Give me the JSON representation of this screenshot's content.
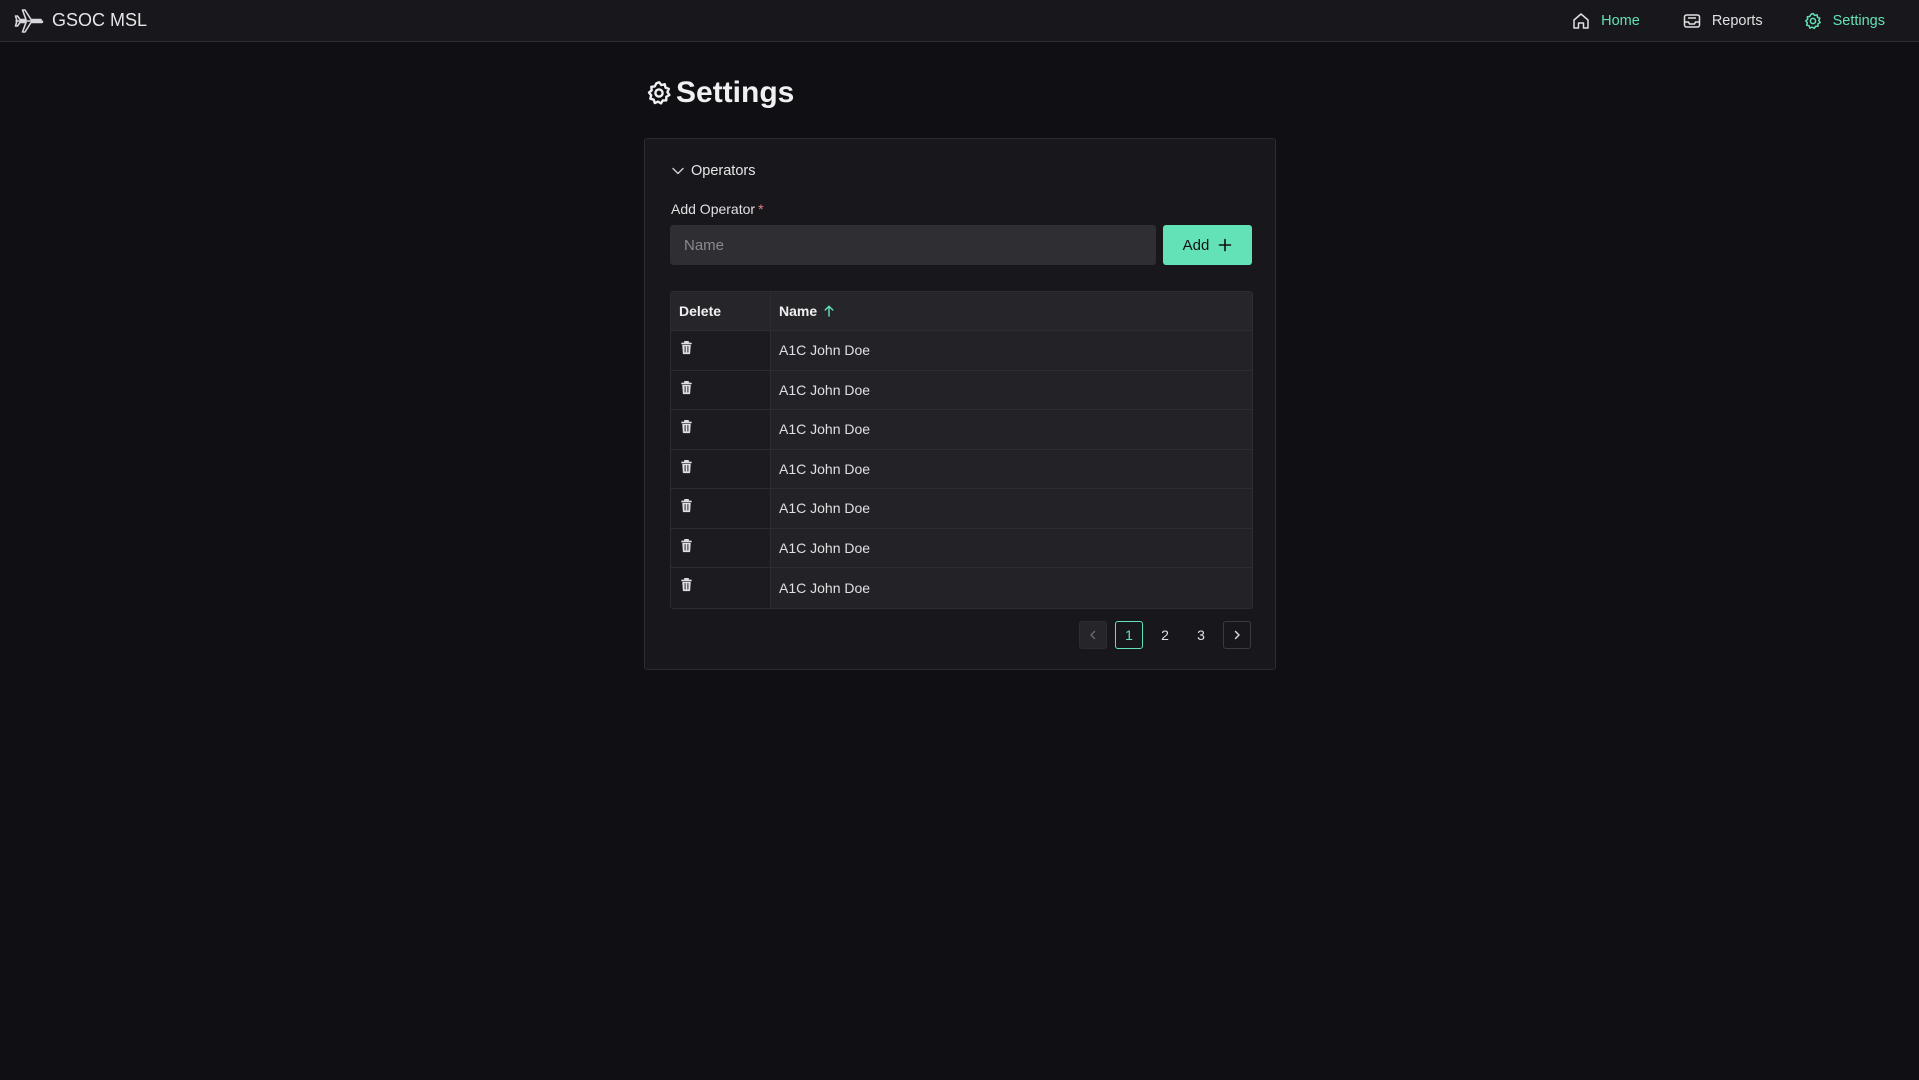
{
  "app": {
    "title": "GSOC MSL"
  },
  "nav": {
    "items": [
      {
        "label": "Home",
        "icon": "home-icon",
        "active": false
      },
      {
        "label": "Reports",
        "icon": "reports-icon",
        "active": false
      },
      {
        "label": "Settings",
        "icon": "settings-icon",
        "active": true
      }
    ]
  },
  "page": {
    "title": "Settings"
  },
  "operators": {
    "section_label": "Operators",
    "add_label": "Add Operator",
    "required_mark": "*",
    "name_placeholder": "Name",
    "name_value": "",
    "add_button": "Add",
    "table": {
      "columns": [
        "Delete",
        "Name"
      ],
      "sort_column": "Name",
      "sort_direction": "ascending",
      "rows": [
        {
          "name": "A1C John Doe"
        },
        {
          "name": "A1C John Doe"
        },
        {
          "name": "A1C John Doe"
        },
        {
          "name": "A1C John Doe"
        },
        {
          "name": "A1C John Doe"
        },
        {
          "name": "A1C John Doe"
        },
        {
          "name": "A1C John Doe"
        }
      ]
    },
    "pagination": {
      "pages": [
        "1",
        "2",
        "3"
      ],
      "current": "1"
    }
  },
  "colors": {
    "accent": "#63e2b7",
    "background": "#101014",
    "surface": "#18181c",
    "required": "#e88080"
  }
}
